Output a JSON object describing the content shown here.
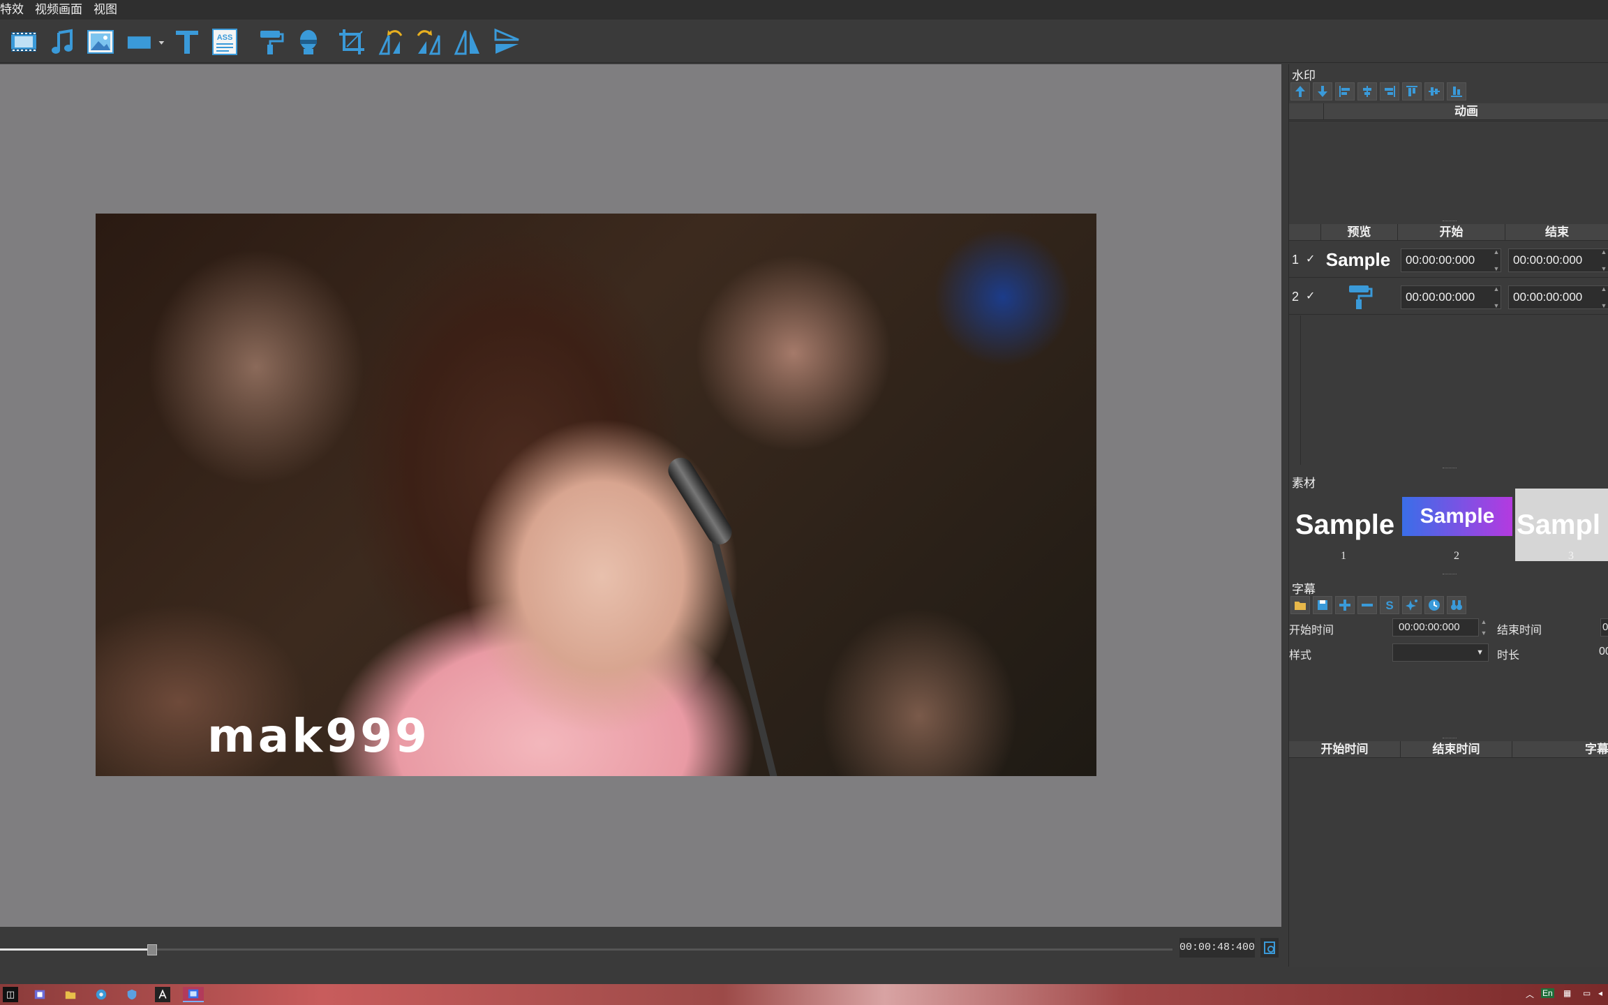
{
  "menu": {
    "items": [
      "特效",
      "视频画面",
      "视图"
    ]
  },
  "toolbar": {
    "icons": [
      "film-icon",
      "music-icon",
      "image-icon",
      "rectangle-icon",
      "text-icon",
      "ass-subtitle-icon",
      "paint-roller-icon",
      "mask-icon",
      "crop-icon",
      "rotate-left-icon",
      "rotate-right-icon",
      "flip-horizontal-icon",
      "flip-vertical-icon"
    ],
    "ass_label": "ASS"
  },
  "preview": {
    "watermark_text": "mak999"
  },
  "timeline": {
    "position": 0.13,
    "timecode": "00:00:48:400"
  },
  "panel": {
    "watermark": {
      "title": "水印",
      "animation_header": "动画",
      "columns": {
        "preview": "预览",
        "start": "开始",
        "end": "结束"
      },
      "rows": [
        {
          "num": "1",
          "check": "✓",
          "preview": "Sample",
          "start": "00:00:00:000",
          "end": "00:00:00:000"
        },
        {
          "num": "2",
          "check": "✓",
          "preview": "paint-roller-icon",
          "start": "00:00:00:000",
          "end": "00:00:00:000"
        }
      ]
    },
    "material": {
      "title": "素材",
      "tiles": [
        {
          "label": "Sample",
          "num": "1"
        },
        {
          "label": "Sample",
          "num": "2"
        },
        {
          "label": "Sampl",
          "num": "3"
        }
      ]
    },
    "subtitle": {
      "title": "字幕",
      "start_label": "开始时间",
      "start_value": "00:00:00:000",
      "end_label": "结束时间",
      "end_value": "0",
      "style_label": "样式",
      "style_value": "",
      "duration_label": "时长",
      "duration_value": "00",
      "list_columns": {
        "start": "开始时间",
        "end": "结束时间",
        "text": "字幕"
      }
    }
  },
  "taskbar": {
    "tray": {
      "language": "En"
    }
  },
  "colors": {
    "accent_blue": "#3a9ad9",
    "tile2_start": "#3a6ee8",
    "tile2_end": "#b43ae0"
  }
}
